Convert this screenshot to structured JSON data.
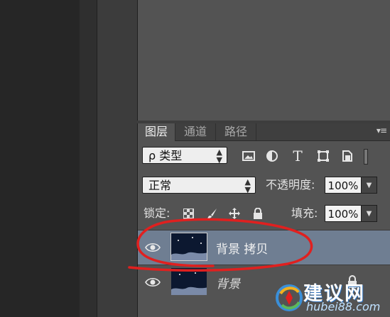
{
  "tabs": [
    {
      "label": "图层",
      "active": true
    },
    {
      "label": "通道",
      "active": false
    },
    {
      "label": "路径",
      "active": false
    }
  ],
  "filter": {
    "kind_label": "ρ 类型",
    "icons": [
      "image-filter-icon",
      "adjustment-filter-icon",
      "type-filter-icon",
      "shape-filter-icon",
      "smart-object-filter-icon"
    ],
    "type_glyph": "T"
  },
  "blend": {
    "mode": "正常",
    "opacity_label": "不透明度:",
    "opacity_value": "100%"
  },
  "lock": {
    "label": "锁定:",
    "icons": [
      "lock-transparent-icon",
      "lock-paint-icon",
      "lock-position-icon",
      "lock-all-icon"
    ],
    "fill_label": "填充:",
    "fill_value": "100%"
  },
  "layers": [
    {
      "name": "背景 拷贝",
      "selected": true,
      "locked": false
    },
    {
      "name": "背景",
      "selected": false,
      "locked": true
    }
  ],
  "watermark": {
    "text": "建议网",
    "url": "hubei88.com"
  },
  "colors": {
    "panel": "#535353",
    "selected_row": "#6f7e92",
    "annotation": "#e0201f"
  }
}
